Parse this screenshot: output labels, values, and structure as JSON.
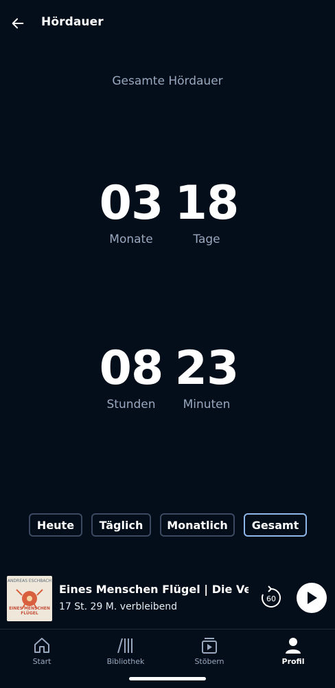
{
  "header": {
    "back_icon": "arrow-left-icon",
    "title": "Hördauer"
  },
  "summary": {
    "subtitle": "Gesamte Hördauer",
    "months": {
      "value": "03",
      "label": "Monate"
    },
    "days": {
      "value": "18",
      "label": "Tage"
    },
    "hours": {
      "value": "08",
      "label": "Stunden"
    },
    "minutes": {
      "value": "23",
      "label": "Minuten"
    }
  },
  "periods": {
    "selected": "Gesamt",
    "options": [
      "Heute",
      "Täglich",
      "Monatlich",
      "Gesamt"
    ]
  },
  "player": {
    "cover": {
      "author": "ANDREAS ESCHBACH",
      "title": "EINES MENSCHEN FLÜGEL"
    },
    "title": "Eines Menschen Flügel | Die Verfolgun",
    "remaining": "17 St. 29 M. verbleibend",
    "rewind_label": "60",
    "rewind_icon": "rewind-60-icon",
    "play_icon": "play-icon"
  },
  "nav": {
    "items": [
      {
        "label": "Start",
        "icon": "home-icon"
      },
      {
        "label": "Bibliothek",
        "icon": "library-icon"
      },
      {
        "label": "Stöbern",
        "icon": "browse-icon"
      },
      {
        "label": "Profil",
        "icon": "profile-icon"
      }
    ],
    "active": "Profil"
  },
  "colors": {
    "background": "#040e1a",
    "text": "#ffffff",
    "muted_text": "#9aa8bf",
    "chip_border": "#3b4a61",
    "chip_active_border": "#8fb8ea"
  }
}
